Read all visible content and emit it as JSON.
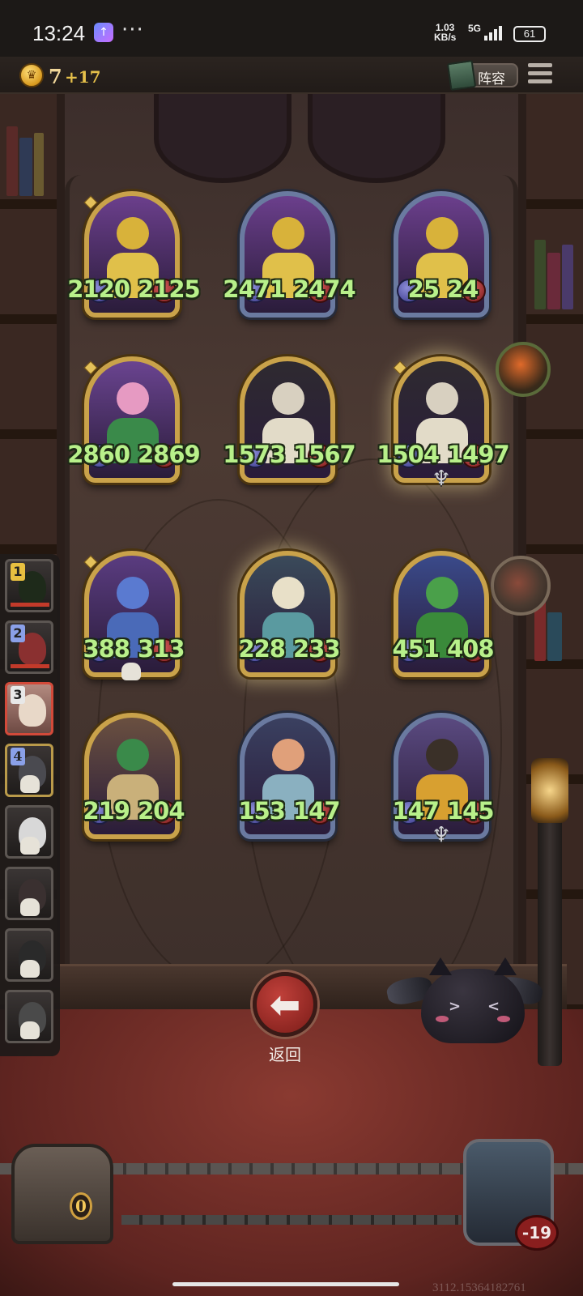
{
  "status_bar": {
    "time": "13:24",
    "more": "···",
    "net_speed_value": "1.03",
    "net_speed_unit": "KB/s",
    "network": "5G",
    "battery": "61"
  },
  "top_bar": {
    "gold": "7",
    "gold_income": "+17",
    "lineup_label": "阵容",
    "coin_icon": "crown-coin-icon",
    "menu_icon": "hamburger-menu-icon"
  },
  "board": {
    "rows": [
      [
        {
          "name": "golden-bookbot",
          "atk": "2120",
          "hp": "2125",
          "frame": "gold",
          "gem": true
        },
        {
          "name": "golden-bookbot",
          "atk": "2471",
          "hp": "2474",
          "frame": "silver",
          "gem": false
        },
        {
          "name": "golden-bookbot",
          "atk": "25",
          "hp": "24",
          "frame": "silver",
          "gem": false
        }
      ],
      [
        {
          "name": "pink-haired-witch",
          "atk": "2860",
          "hp": "2869",
          "frame": "gold",
          "gem": true
        },
        {
          "name": "harlequin-knight",
          "atk": "1573",
          "hp": "1567",
          "frame": "gold",
          "gem": false
        },
        {
          "name": "harlequin-knight",
          "atk": "1504",
          "hp": "1497",
          "frame": "gold",
          "gem": true,
          "glow": true,
          "trident": true
        }
      ],
      [
        {
          "name": "blue-sea-dragon",
          "atk": "388",
          "hp": "313",
          "frame": "gold",
          "gem": true,
          "skull": true
        },
        {
          "name": "white-eastern-dragon",
          "atk": "228",
          "hp": "233",
          "frame": "gold",
          "gem": false,
          "glow": true
        },
        {
          "name": "green-baby-dragon",
          "atk": "451",
          "hp": "408",
          "frame": "gold",
          "gem": false
        }
      ],
      [
        {
          "name": "green-horned-dragon",
          "atk": "219",
          "hp": "204",
          "frame": "gold",
          "gem": false
        },
        {
          "name": "officer-woman",
          "atk": "153",
          "hp": "147",
          "frame": "silver",
          "gem": false
        },
        {
          "name": "dark-armored-knight",
          "atk": "147",
          "hp": "145",
          "frame": "silver",
          "gem": false,
          "trident": true
        }
      ]
    ]
  },
  "roster": [
    {
      "rank": "1",
      "state": "alive"
    },
    {
      "rank": "2",
      "state": "alive"
    },
    {
      "rank": "3",
      "state": "current"
    },
    {
      "rank": "4",
      "state": "dead"
    },
    {
      "rank": "",
      "state": "dead"
    },
    {
      "rank": "",
      "state": "dead"
    },
    {
      "rank": "",
      "state": "dead"
    },
    {
      "rank": "",
      "state": "dead"
    }
  ],
  "back_button": {
    "label": "返回",
    "icon": "arrow-left-icon"
  },
  "bottom": {
    "chest_count": "0",
    "hero_health": "-19",
    "watermark": "3112.15364182761"
  },
  "colors": {
    "stat_green": "#b8f08a",
    "gold_frame": "#c9a24a",
    "silver_frame": "#6a7aa0",
    "back_red": "#b3342e"
  }
}
